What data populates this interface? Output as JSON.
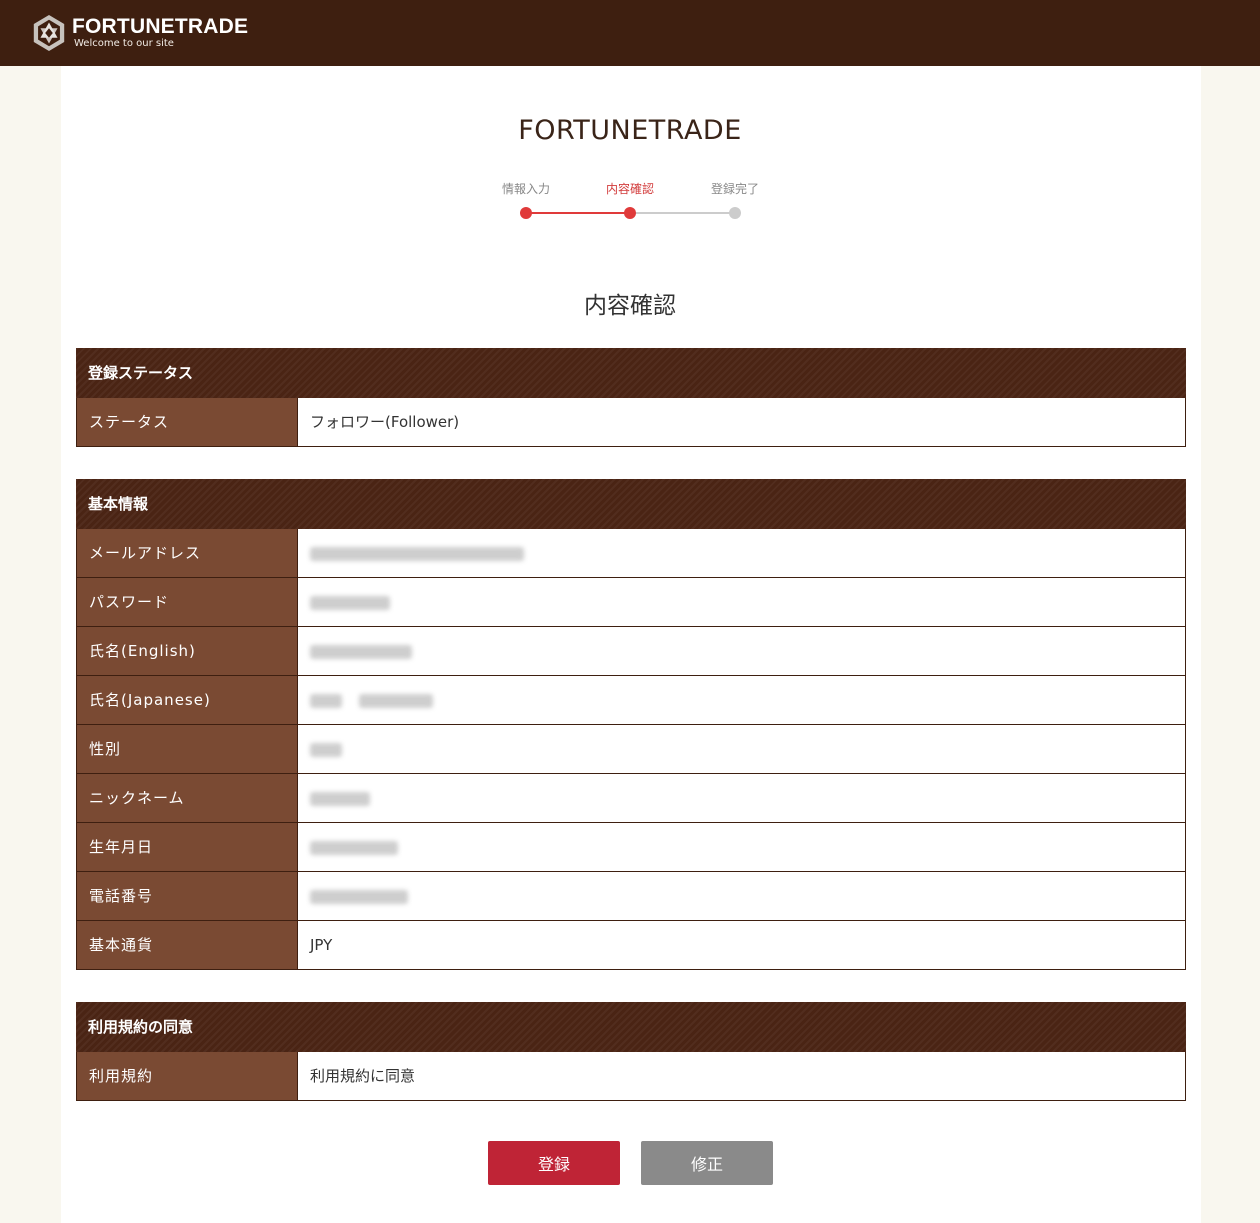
{
  "header": {
    "logo_name": "FORTUNETRADE",
    "logo_tagline": "Welcome to our site"
  },
  "site_title": "FORTUNETRADE",
  "steps": [
    {
      "label": "情報入力",
      "state": "done"
    },
    {
      "label": "内容確認",
      "state": "current"
    },
    {
      "label": "登録完了",
      "state": "pending"
    }
  ],
  "page_heading": "内容確認",
  "sections": {
    "status": {
      "title": "登録ステータス",
      "rows": [
        {
          "label": "ステータス",
          "value": "フォロワー(Follower)"
        }
      ]
    },
    "basic": {
      "title": "基本情報",
      "rows": [
        {
          "label": "メールアドレス",
          "value": "",
          "redacted": true
        },
        {
          "label": "パスワード",
          "value": "",
          "redacted": true
        },
        {
          "label": "氏名(English)",
          "value": "",
          "redacted": true
        },
        {
          "label": "氏名(Japanese)",
          "value": "",
          "redacted": true
        },
        {
          "label": "性別",
          "value": "",
          "redacted": true
        },
        {
          "label": "ニックネーム",
          "value": "",
          "redacted": true
        },
        {
          "label": "生年月日",
          "value": "",
          "redacted": true
        },
        {
          "label": "電話番号",
          "value": "",
          "redacted": true
        },
        {
          "label": "基本通貨",
          "value": "JPY"
        }
      ]
    },
    "terms": {
      "title": "利用規約の同意",
      "rows": [
        {
          "label": "利用規約",
          "value": "利用規約に同意"
        }
      ]
    }
  },
  "buttons": {
    "register_label": "登録",
    "modify_label": "修正"
  },
  "colors": {
    "header_bg": "#3e1f10",
    "row_label_bg": "#7a4a33",
    "step_active": "#e03a3a",
    "step_pending": "#cccccc",
    "register_button": "#bf2436",
    "modify_button": "#8a8a8a"
  }
}
